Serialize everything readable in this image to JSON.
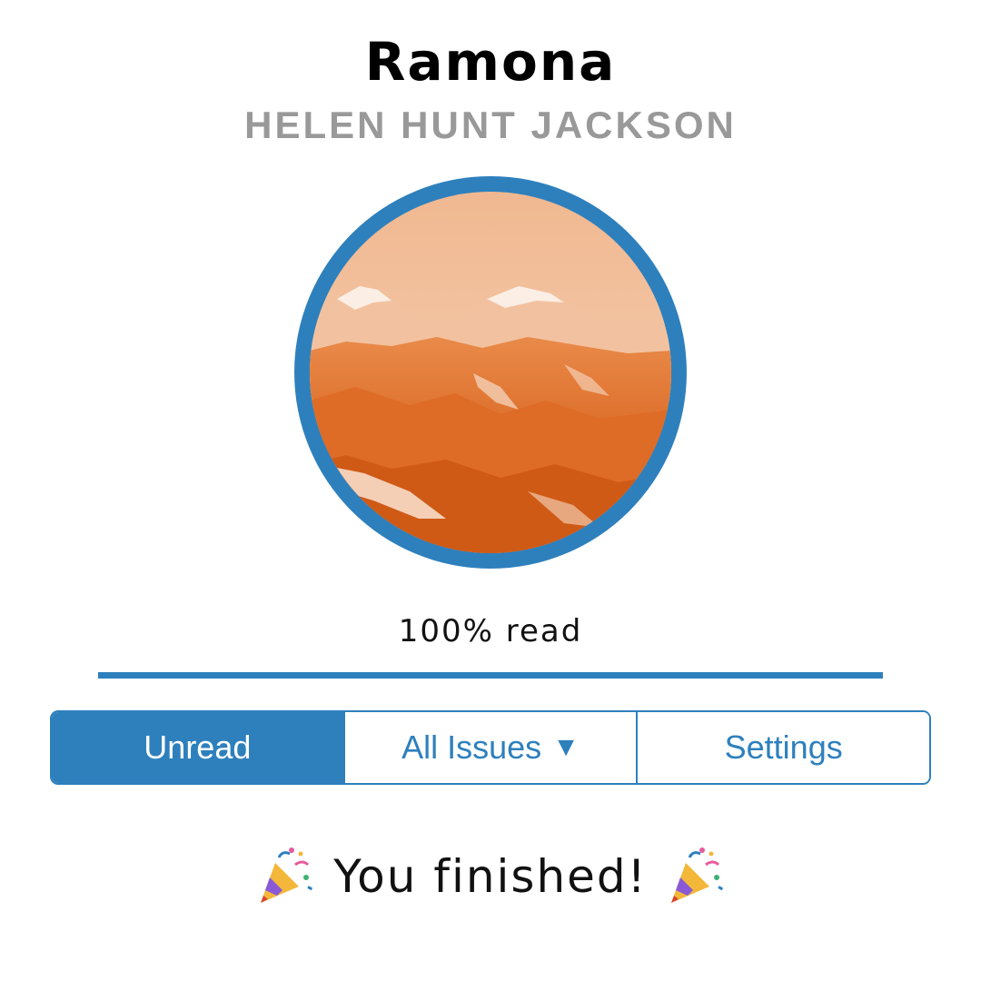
{
  "book": {
    "title": "Ramona",
    "author": "HELEN HUNT JACKSON"
  },
  "cover": {
    "image": "mountain-range-photo",
    "tint_color": "#e8762f",
    "ring_color": "#2e80bd"
  },
  "progress": {
    "label": "100% read",
    "fraction": 1.0
  },
  "tabs": [
    {
      "label": "Unread",
      "active": true
    },
    {
      "label": "All Issues",
      "icon": "caret-down-icon",
      "active": false
    },
    {
      "label": "Settings",
      "active": false
    }
  ],
  "completion": {
    "message": "You finished!",
    "icon": "party-popper-icon"
  },
  "colors": {
    "accent": "#2e80bd",
    "author_gray": "#999999"
  }
}
